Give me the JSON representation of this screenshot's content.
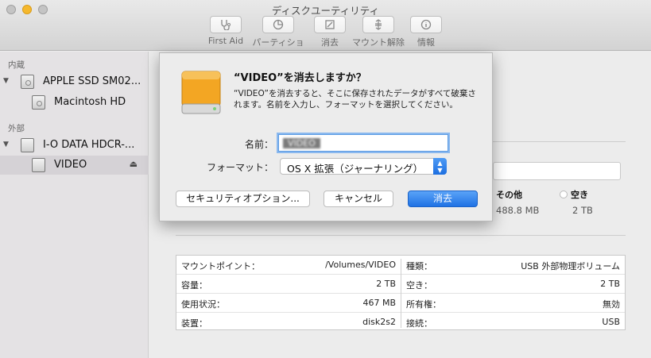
{
  "window": {
    "title": "ディスクユーティリティ"
  },
  "toolbar": {
    "items": [
      {
        "label": "First Aid",
        "icon": "stethoscope-icon"
      },
      {
        "label": "パーティション",
        "icon": "pie-chart-icon"
      },
      {
        "label": "消去",
        "icon": "erase-icon"
      },
      {
        "label": "マウント解除",
        "icon": "unmount-icon"
      },
      {
        "label": "情報",
        "icon": "info-icon"
      }
    ]
  },
  "sidebar": {
    "internal_label": "内蔵",
    "external_label": "外部",
    "items": [
      {
        "label": "APPLE SSD SM02..."
      },
      {
        "label": "Macintosh HD"
      },
      {
        "label": "I-O DATA HDCR-..."
      },
      {
        "label": "VIDEO",
        "eject": "⏏"
      }
    ]
  },
  "usage": {
    "other_label": "その他",
    "other_value": "488.8 MB",
    "free_label": "空き",
    "free_value": "2 TB"
  },
  "info": {
    "left": [
      {
        "k": "マウントポイント：",
        "v": "/Volumes/VIDEO"
      },
      {
        "k": "容量：",
        "v": "2 TB"
      },
      {
        "k": "使用状況：",
        "v": "467 MB"
      },
      {
        "k": "装置：",
        "v": "disk2s2"
      }
    ],
    "right": [
      {
        "k": "種類：",
        "v": "USB 外部物理ボリューム"
      },
      {
        "k": "空き：",
        "v": "2 TB"
      },
      {
        "k": "所有権：",
        "v": "無効"
      },
      {
        "k": "接続：",
        "v": "USB"
      }
    ]
  },
  "dialog": {
    "title": "“VIDEO”を消去しますか？",
    "message": "“VIDEO”を消去すると、そこに保存されたデータがすべて破棄されます。名前を入力し、フォーマットを選択してください。",
    "name_label": "名前：",
    "name_value": "VIDEO",
    "format_label": "フォーマット：",
    "format_value": "OS X 拡張（ジャーナリング）",
    "security_button": "セキュリティオプション...",
    "cancel_button": "キャンセル",
    "erase_button": "消去",
    "accent": "#1f72e4"
  }
}
